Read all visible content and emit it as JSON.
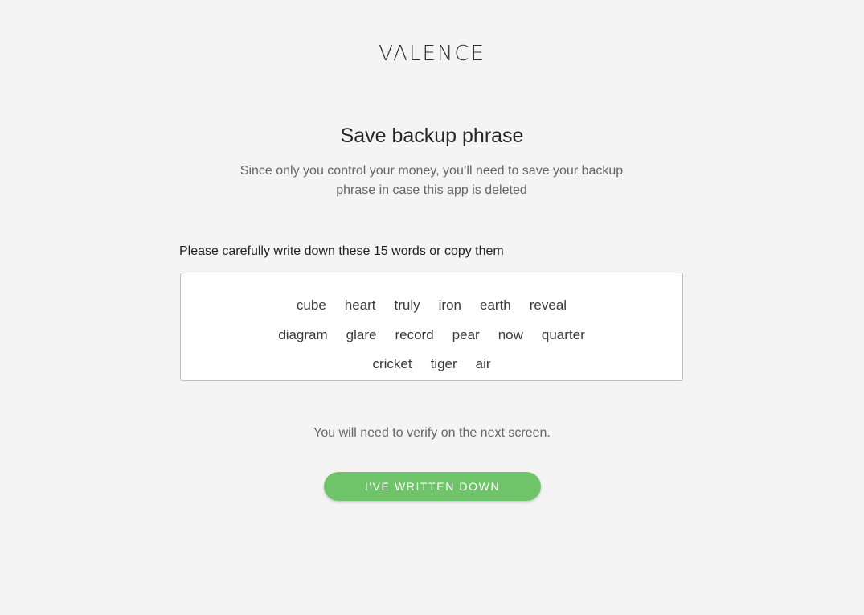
{
  "brand": {
    "logo_text": "VALENCE"
  },
  "header": {
    "title": "Save backup phrase",
    "subtitle": "Since only you control your money, you’ll need to save your backup phrase in case this app is deleted"
  },
  "phrase": {
    "instruction": "Please carefully write down these 15 words or copy them",
    "rows": [
      [
        "cube",
        "heart",
        "truly",
        "iron",
        "earth",
        "reveal"
      ],
      [
        "diagram",
        "glare",
        "record",
        "pear",
        "now",
        "quarter"
      ],
      [
        "cricket",
        "tiger",
        "air"
      ]
    ]
  },
  "footer": {
    "verify_note": "You will need to verify on the next screen.",
    "confirm_button_label": "I'VE WRITTEN DOWN"
  },
  "colors": {
    "background": "#f4f4f4",
    "accent_green": "#6fc46a",
    "box_border": "#bdbdbd"
  }
}
